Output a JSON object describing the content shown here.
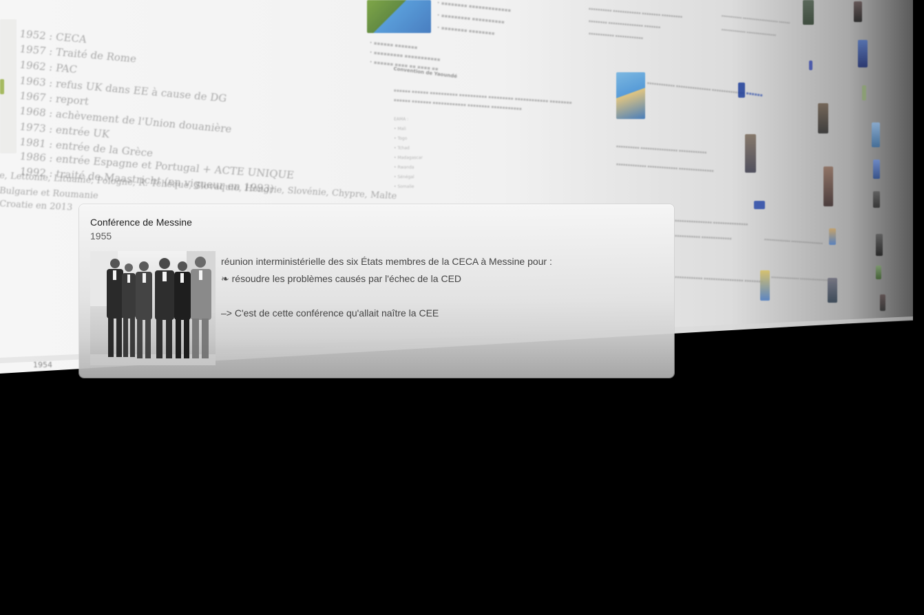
{
  "background_timeline": {
    "left_column": [
      "1952 : CECA",
      "1957 : Traité de Rome",
      "1962 : PAC",
      "1963 : refus UK dans EE à cause de DG",
      "1967 : report",
      "1968 : achèvement de l'Union douanière",
      "1973 : entrée UK",
      "1981 : entrée de la Grèce",
      "1986 : entrée Espagne et Portugal + ACTE UNIQUE",
      "1992 : traité de Maastricht (en vigueur en 1993)",
      "e, Lettonie, Lituanie, Pologne, R. Tchèque, Slovaquie,   Hongrie, Slovénie, Chypre, Malte",
      "Bulgarie et Roumanie",
      "Croatie en 2013"
    ],
    "bottom_year": "1954",
    "mid_heading": "Convention de Yaoundé",
    "mid_list": [
      "EAMA :",
      "• Mali",
      "• Togo",
      "• Tchad",
      "• Madagascar",
      "• Rwanda",
      "• Sénégal",
      "• Somalie"
    ],
    "colors": {
      "plane_light": "#f4f4f4",
      "plane_dark": "#9a9a9a",
      "eu_blue": "#1f3f9a",
      "map_blue": "#3f8fd6",
      "map_green": "#6c9a2c"
    }
  },
  "card": {
    "title": "Conférence de Messine",
    "year": "1955",
    "body_line_1": "réunion interministérielle des six États membres de la CECA à Messine pour :",
    "body_line_2": "❧ résoudre les problèmes causés par l'échec de la CED",
    "body_line_3": "–> C'est de cette conférence qu'allait naître la CEE",
    "photo_icon": "group-photo-icon"
  }
}
